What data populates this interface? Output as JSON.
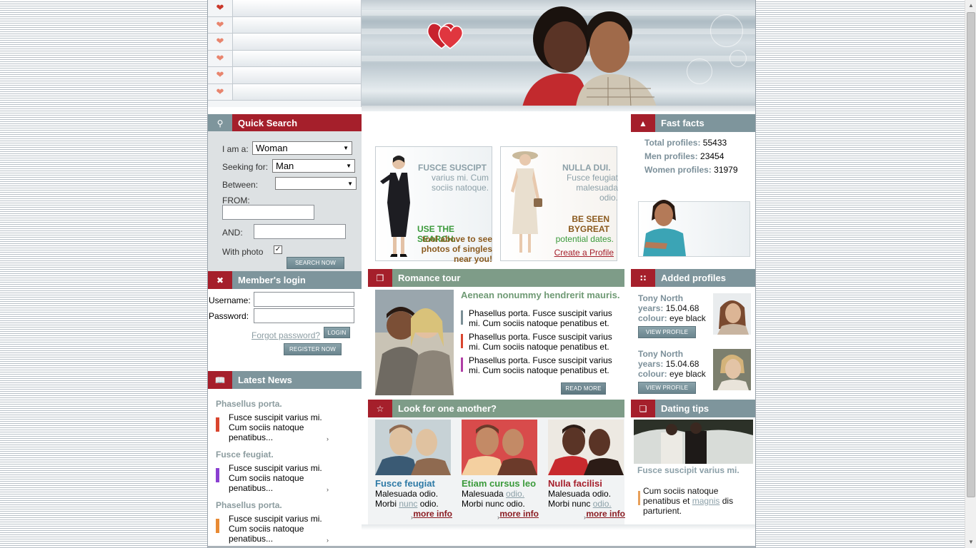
{
  "quick_search": {
    "title": "Quick Search",
    "i_am_label": "I am a:",
    "i_am_value": "Woman",
    "seeking_label": "Seeking for:",
    "seeking_value": "Man",
    "between_label": "Between:",
    "between_value": "",
    "from_label": "FROM:",
    "and_label": "AND:",
    "photo_label": "With photo",
    "button": "SEARCH NOW"
  },
  "login": {
    "title": "Member's login",
    "username_label": "Username:",
    "password_label": "Password:",
    "forgot": "Forgot password?",
    "login_button": "LOGIN",
    "register_button": "REGISTER NOW"
  },
  "news": {
    "title": "Latest News",
    "items": [
      {
        "heading": "Phasellus porta.",
        "text": "Fusce suscipit varius mi. Cum sociis natoque penatibus...",
        "color": "#d9452e"
      },
      {
        "heading": "Fusce feugiat.",
        "text": "Fusce suscipit varius mi. Cum sociis natoque penatibus...",
        "color": "#8a3fd1"
      },
      {
        "heading": "Phasellus porta.",
        "text": "Fusce suscipit varius mi. Cum sociis natoque penatibus...",
        "color": "#e88a34"
      }
    ]
  },
  "promo": {
    "left": {
      "title": "FUSCE SUSCIPT",
      "sub": "varius mi. Cum sociis natoque.",
      "cta_green": "USE THE SEARCH.",
      "cta_brown": "tool above to see photos of singles near you!"
    },
    "right": {
      "title": "NULLA DUI.",
      "sub": "Fusce feugiat malesuada odio.",
      "cta_brown": "BE SEEN BYGREAT",
      "cta_green": "potential dates.",
      "link": "Create a Profile"
    }
  },
  "romance": {
    "title": "Romance tour",
    "headline": "Aenean nonummy hendrerit mauris.",
    "items": [
      {
        "text": "Phasellus porta. Fusce suscipit varius mi. Cum sociis natoque penatibus et.",
        "color": "#7b8f96"
      },
      {
        "text": "Phasellus porta. Fusce suscipit varius mi. Cum sociis natoque penatibus et.",
        "color": "#d9452e"
      },
      {
        "text": "Phasellus porta. Fusce suscipit varius mi. Cum sociis natoque penatibus et.",
        "color": "#b03fa6"
      }
    ],
    "button": "READ MORE"
  },
  "look": {
    "title": "Look for one another?",
    "cards": [
      {
        "name": "Fusce feugiat",
        "line1a": "Malesuada odio.",
        "line1b": "",
        "line2a": "Morbi ",
        "line2b": "nunc",
        "line2c": " odio.",
        "more": "more info",
        "color": "#2e7aa6"
      },
      {
        "name": "Etiam cursus leo",
        "line1a": "Malesuada ",
        "line1b": "odio.",
        "line2a": "Morbi nunc odio.",
        "line2b": "",
        "line2c": "",
        "more": "more info",
        "color": "#3a9a3a"
      },
      {
        "name": "Nulla facilisi",
        "line1a": "Malesuada odio.",
        "line1b": "",
        "line2a": "Morbi nunc ",
        "line2b": "odio.",
        "line2c": "",
        "more": "more info",
        "color": "#a51f2b"
      }
    ]
  },
  "facts": {
    "title": "Fast facts",
    "total_label": "Total profiles:",
    "total": "55433",
    "men_label": "Men profiles:",
    "men": "23454",
    "women_label": "Women profiles:",
    "women": "31979"
  },
  "added": {
    "title": "Added profiles",
    "profiles": [
      {
        "name": "Tony North",
        "years_label": "years:",
        "years": "15.04.68",
        "colour_label": "colour:",
        "colour": "eye black",
        "button": "VIEW PROFILE"
      },
      {
        "name": "Tony North",
        "years_label": "years:",
        "years": "15.04.68",
        "colour_label": "colour:",
        "colour": "eye black",
        "button": "VIEW PROFILE"
      }
    ]
  },
  "tips": {
    "title": "Dating tips",
    "headline": "Fusce suscipit varius mi.",
    "text_a": "Cum sociis natoque penatibus et ",
    "text_link": "magnis",
    "text_b": " dis parturient."
  }
}
